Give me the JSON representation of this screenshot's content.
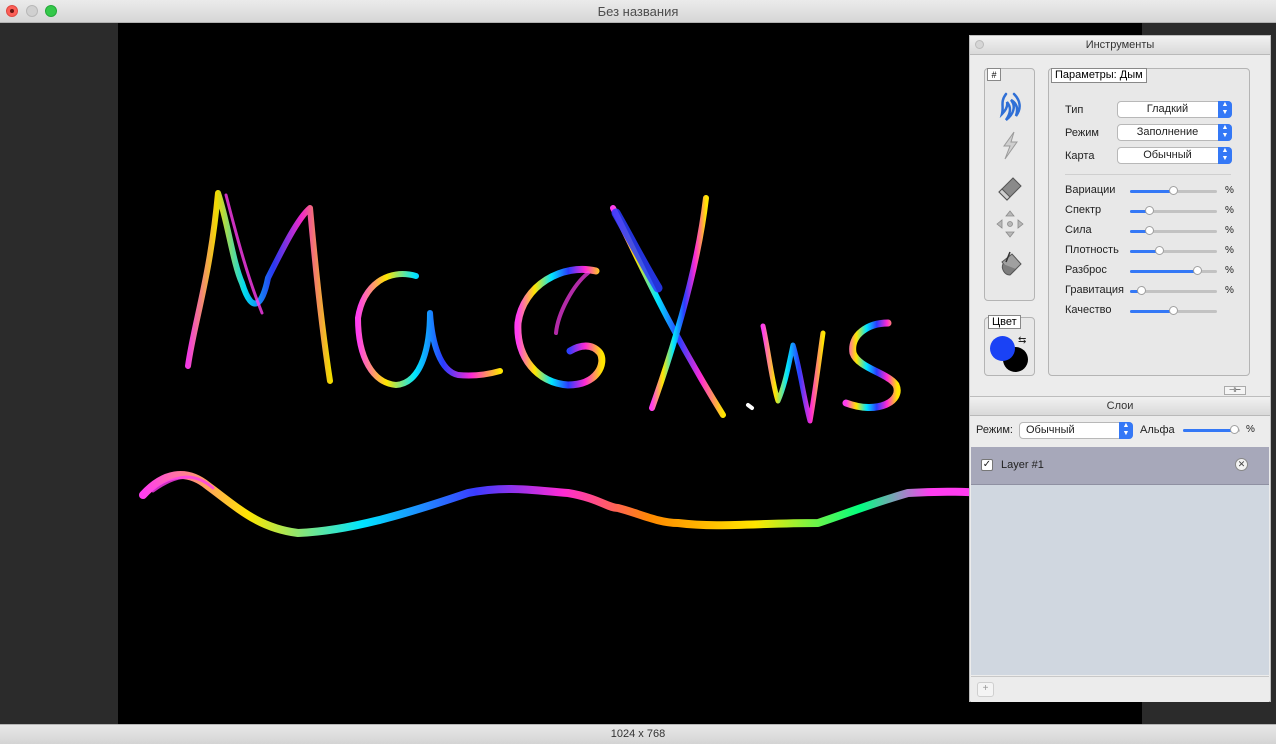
{
  "window": {
    "title": "Без названия"
  },
  "status": {
    "dimensions": "1024 x 768"
  },
  "tools_panel": {
    "title": "Инструменты",
    "tool_grid_label": "#",
    "tools": [
      "smoke-brush-icon",
      "lightning-brush-icon",
      "eraser-icon",
      "move-icon",
      "fill-bucket-icon"
    ],
    "color_label": "Цвет",
    "foreground_color": "#1a42f5",
    "background_color": "#000000",
    "params_title": "Параметры: Дым",
    "selects": [
      {
        "label": "Тип",
        "value": "Гладкий"
      },
      {
        "label": "Режим",
        "value": "Заполнение"
      },
      {
        "label": "Карта",
        "value": "Обычный"
      }
    ],
    "sliders": [
      {
        "label": "Вариации",
        "value": 0.5,
        "unit": "%"
      },
      {
        "label": "Спектр",
        "value": 0.23,
        "unit": "%"
      },
      {
        "label": "Сила",
        "value": 0.23,
        "unit": "%"
      },
      {
        "label": "Плотность",
        "value": 0.35,
        "unit": "%"
      },
      {
        "label": "Разброс",
        "value": 0.78,
        "unit": "%"
      },
      {
        "label": "Гравитация",
        "value": 0.14,
        "unit": "%"
      },
      {
        "label": "Качество",
        "value": 0.5,
        "unit": ""
      }
    ]
  },
  "layers_panel": {
    "title": "Слои",
    "mode_label": "Режим:",
    "mode_value": "Обычный",
    "alpha_label": "Альфа",
    "alpha_value": 0.92,
    "alpha_unit": "%",
    "layers": [
      {
        "name": "Layer #1",
        "visible": true
      }
    ],
    "add_label": "+"
  }
}
